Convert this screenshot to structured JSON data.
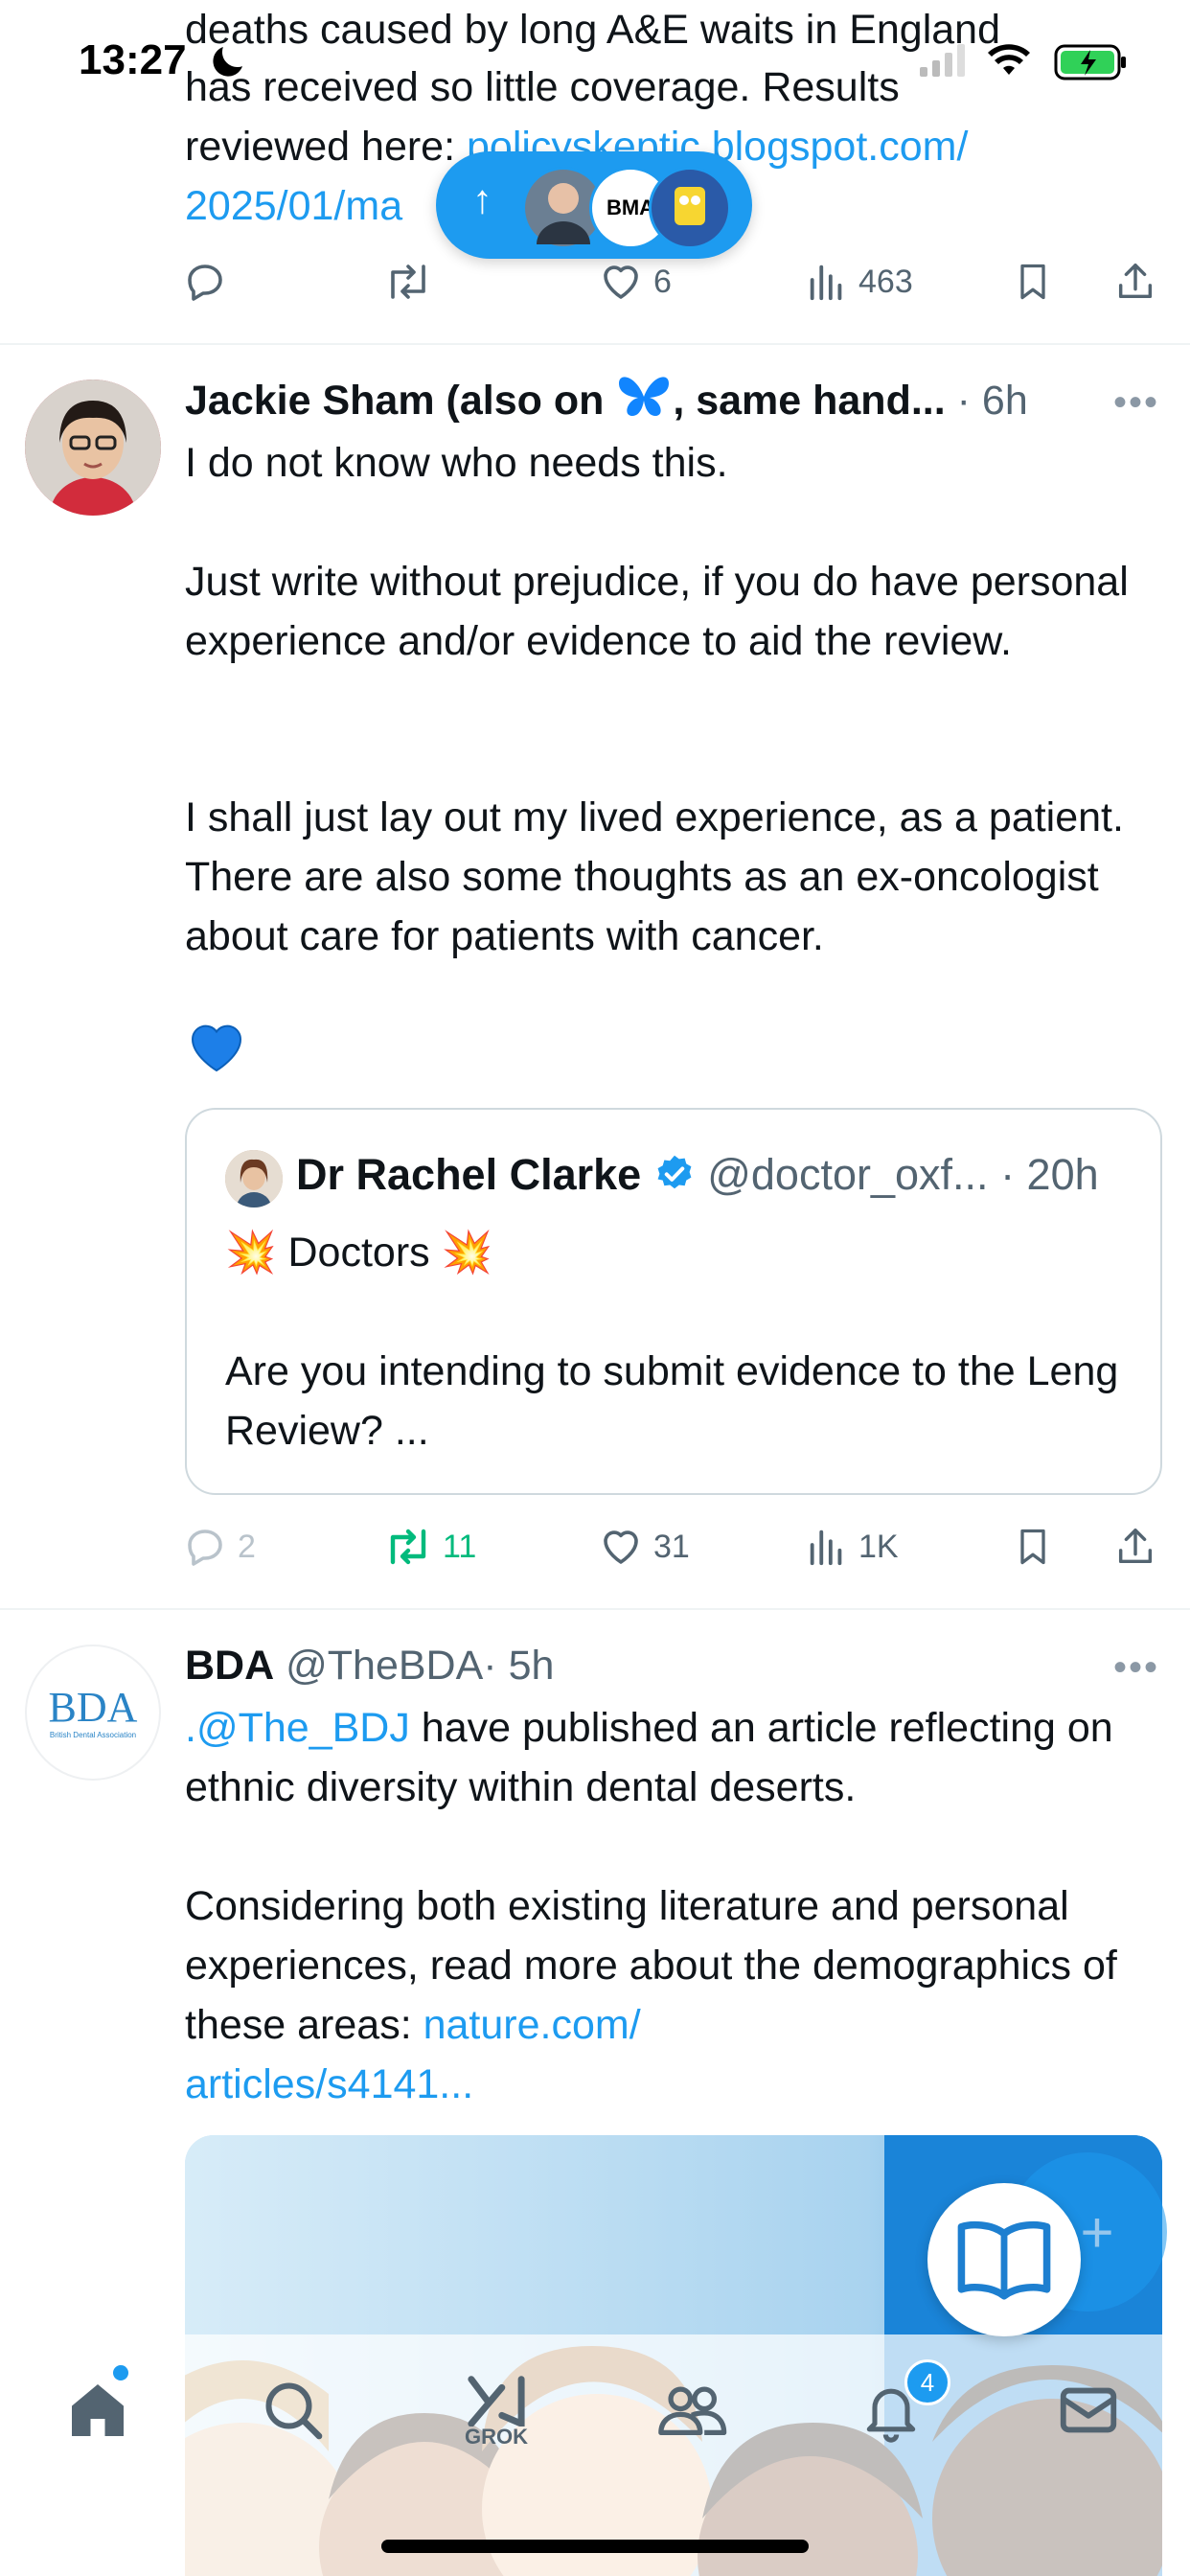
{
  "status_bar": {
    "time": "13:27"
  },
  "top_post": {
    "line1": "deaths caused by long A&E waits in England",
    "line2": "has received so little coverage. Results",
    "line3_text": "reviewed here: ",
    "line3_link": "policyskeptic.blogspot.com/",
    "line4_link": "2025/01/ma",
    "actions": {
      "replies": "",
      "reposts": "",
      "likes": "6",
      "views": "463"
    }
  },
  "new_posts_pill": {
    "arrow": "↑",
    "avatar_label": "BMA"
  },
  "post1": {
    "author": "Jackie Sham (also on",
    "author_suffix": ", same hand...",
    "time": "· 6h",
    "para1": "I do not know who needs this.",
    "para2": "Just write without prejudice, if you do have personal experience and/or evidence to aid the review.",
    "para3": "I shall just lay out my lived experience, as a patient. There are also some thoughts as an ex-oncologist about care for patients with cancer.",
    "emoji": "💙",
    "quote": {
      "author": "Dr Rachel Clarke",
      "handle": "@doctor_oxf...",
      "time": "· 20h",
      "line1": "💥 Doctors 💥",
      "line2": "Are you intending to submit evidence to the Leng Review? ..."
    },
    "actions": {
      "replies": "2",
      "reposts": "11",
      "likes": "31",
      "views": "1K"
    }
  },
  "post2": {
    "author": "BDA",
    "handle": "@TheBDA",
    "time": "· 5h",
    "avatar_text": "BDA",
    "avatar_subtext": "British Dental Association",
    "para1_link": ".@The_BDJ",
    "para1_text": " have published an article reflecting on ethnic diversity within dental deserts.",
    "para2_text": "Considering both existing literature and personal experiences, read more about the demographics of these areas: ",
    "para2_link1": "nature.com/",
    "para2_link2": "articles/s4141..."
  },
  "fab": {
    "compose_label": "+"
  },
  "bottom_nav": {
    "grok_label": "GROK",
    "notifications_badge": "4"
  },
  "colors": {
    "accent": "#1d9bf0",
    "repost_green": "#00ba7c",
    "text": "#0f1419",
    "muted": "#536471"
  }
}
